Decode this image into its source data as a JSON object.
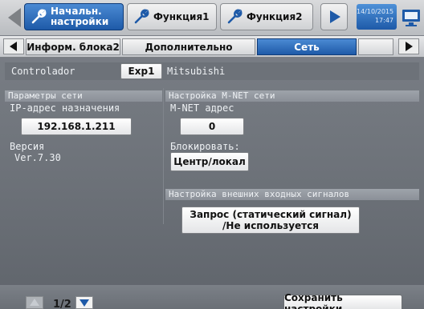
{
  "header": {
    "tabs": [
      {
        "label_line1": "Начальн.",
        "label_line2": "настройки",
        "active": true
      },
      {
        "label": "Функция1",
        "active": false
      },
      {
        "label": "Функция2",
        "active": false
      }
    ],
    "date": "14/10/2015",
    "time": "17:47"
  },
  "subtabs": [
    {
      "label": "Информ. блока2",
      "active": false
    },
    {
      "label": "Дополнительно",
      "active": false
    },
    {
      "label": "Сеть",
      "active": true
    }
  ],
  "controller": {
    "label": "Controlador",
    "button": "Exp1",
    "name": "Mitsubishi"
  },
  "network": {
    "header": "Параметры сети",
    "ip_label": "IP-адрес назначения",
    "ip_value": "192.168.1.211",
    "version_label": "Версия",
    "version_value": "Ver.7.30"
  },
  "mnet": {
    "header": "Настройка M-NET сети",
    "address_label": "M-NET адрес",
    "address_value": "0",
    "lock_label": "Блокировать:",
    "lock_value": "Центр/локал"
  },
  "external": {
    "header": "Настройка внешних входных сигналов",
    "button_line1": "Запрос (статический сигнал)",
    "button_line2": "/Не используется"
  },
  "footer": {
    "page": "1/2",
    "save": "Сохранить настройки"
  },
  "colors": {
    "accent": "#1e5aa8",
    "background": "#6c7178"
  }
}
